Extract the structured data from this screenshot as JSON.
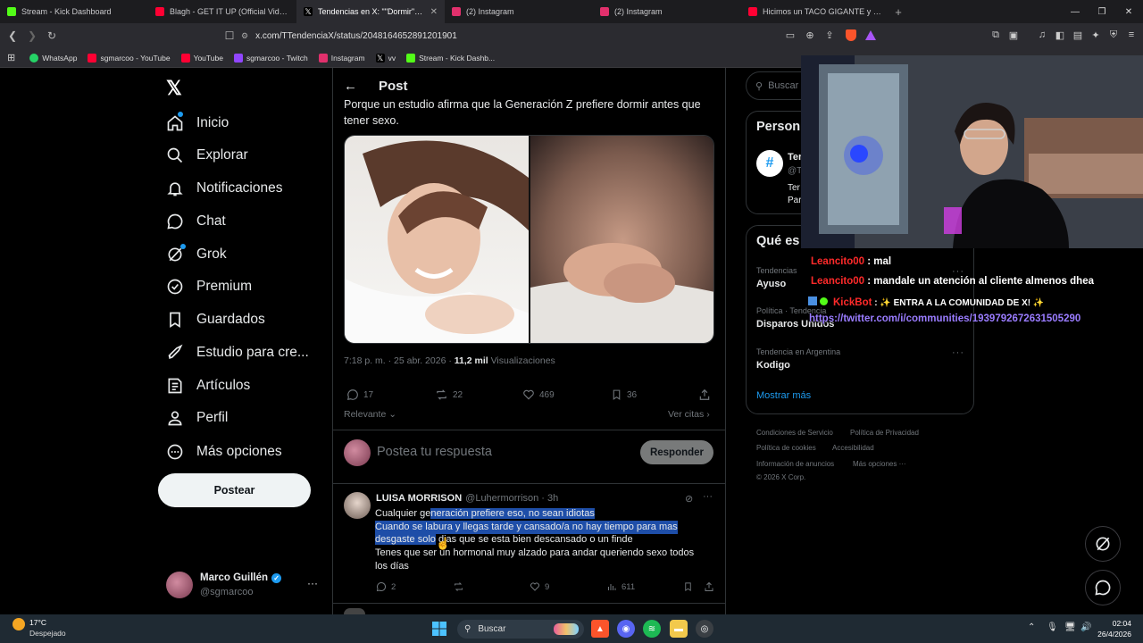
{
  "browser": {
    "tabs": [
      {
        "title": "Stream - Kick Dashboard",
        "color": "#53fc18"
      },
      {
        "title": "Blagh - GET IT UP (Official Video) - Yo",
        "color": "#ff0033"
      },
      {
        "title": "Tendencias en X: \"\"Dormir\": Porq",
        "color": "#ffffff",
        "active": true
      },
      {
        "title": "(2) Instagram",
        "color": "#e1306c"
      },
      {
        "title": "(2) Instagram",
        "color": "#e1306c"
      },
      {
        "title": "Hicimos un TACO GIGANTE y se fue d",
        "color": "#ff0033"
      }
    ],
    "url": "x.com/TTendenciaX/status/2048164652891201901",
    "bookmarks": [
      {
        "label": "WhatsApp",
        "color": "#25d366"
      },
      {
        "label": "sgmarcoo - YouTube",
        "color": "#ff0033"
      },
      {
        "label": "YouTube",
        "color": "#ff0033"
      },
      {
        "label": "sgmarcoo - Twitch",
        "color": "#9146ff"
      },
      {
        "label": "Instagram",
        "color": "#e1306c"
      },
      {
        "label": "vv",
        "color": "#ffffff"
      },
      {
        "label": "Stream - Kick Dashb...",
        "color": "#53fc18"
      }
    ]
  },
  "sidebar": {
    "items": [
      {
        "label": "Inicio",
        "icon": "home-icon"
      },
      {
        "label": "Explorar",
        "icon": "search-icon"
      },
      {
        "label": "Notificaciones",
        "icon": "bell-icon"
      },
      {
        "label": "Chat",
        "icon": "chat-icon"
      },
      {
        "label": "Grok",
        "icon": "grok-icon"
      },
      {
        "label": "Premium",
        "icon": "premium-icon"
      },
      {
        "label": "Guardados",
        "icon": "bookmark-icon"
      },
      {
        "label": "Estudio para cre...",
        "icon": "rocket-icon"
      },
      {
        "label": "Artículos",
        "icon": "article-icon"
      },
      {
        "label": "Perfil",
        "icon": "person-icon"
      },
      {
        "label": "Más opciones",
        "icon": "more-circle-icon"
      }
    ],
    "post_button": "Postear",
    "account": {
      "name": "Marco Guillén",
      "handle": "@sgmarcoo"
    }
  },
  "post": {
    "header": "Post",
    "text": "Porque un estudio afirma que la Generación Z prefiere dormir antes que tener sexo.",
    "time": "7:18 p. m. · 25 abr. 2026 · ",
    "views_count": "11,2 mil",
    "views_label": " Visualizaciones",
    "replies": "17",
    "reposts": "22",
    "likes": "469",
    "bookmarks": "36",
    "sort_label": "Relevante",
    "quotes_label": "Ver citas",
    "reply_placeholder": "Postea tu respuesta",
    "reply_button": "Responder"
  },
  "comment": {
    "name": "LUISA MORRISON",
    "handle": "@Luhermorrison · 3h",
    "line1_a": "Cualquier ge",
    "line1_b": "neración prefiere eso, no sean idiotas",
    "line2": "Cuando se labura y llegas tarde y cansado/a no hay tiempo para mas",
    "line3_a": "desgaste solo",
    "line3_b": " dias que se esta bien descansado o un finde",
    "line4": "Tenes que ser un hormonal muy alzado para andar queriendo sexo todos",
    "line5": "los días",
    "replies": "2",
    "likes": "9",
    "views": "611"
  },
  "right": {
    "search_placeholder": "Buscar",
    "who_title": "Person",
    "who_name": "Ter",
    "who_handle": "@T",
    "who_desc1": "Ter",
    "who_desc2": "Par",
    "trends_title": "Qué es",
    "trends": [
      {
        "category": "Tendencias",
        "name": "Ayuso"
      },
      {
        "category": "Política · Tendencia",
        "name": "Disparos Unidos"
      },
      {
        "category": "Tendencia en Argentina",
        "name": "Kodigo"
      }
    ],
    "show_more": "Mostrar más",
    "footer": [
      "Condiciones de Servicio",
      "Política de Privacidad",
      "Política de cookies",
      "Accesibilidad",
      "Información de anuncios",
      "Más opciones ···",
      "© 2026 X Corp."
    ]
  },
  "chat": [
    {
      "user": "Leancito00",
      "msg": " : mal"
    },
    {
      "user": "Leancito00",
      "msg": " : mandale un atención al cliente almenos dhea"
    },
    {
      "user": "KickBot",
      "msg": " : ✨ ENTRA A LA COMUNIDAD DE X! ✨"
    },
    {
      "user": "",
      "msg": "https://twitter.com/i/communities/1939792672631505290"
    }
  ],
  "taskbar": {
    "weather_temp": "17°C",
    "weather_desc": "Despejado",
    "search": "Buscar",
    "time": "02:04",
    "date": "26/4/2026"
  }
}
